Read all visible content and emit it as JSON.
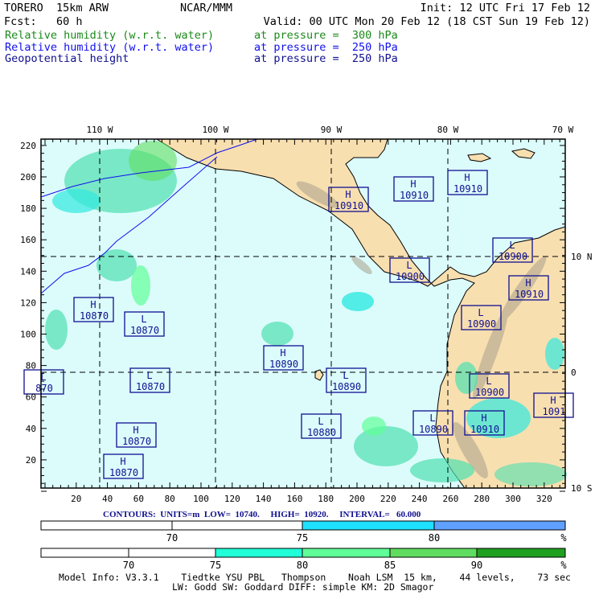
{
  "header": {
    "model": "TORERO  15km ARW",
    "center": "NCAR/MMM",
    "init": "Init: 12 UTC Fri 17 Feb 12",
    "fcst": "Fcst:   60 h",
    "valid": "Valid: 00 UTC Mon 20 Feb 12 (18 CST Sun 19 Feb 12)"
  },
  "fields": [
    {
      "name": "Relative humidity (w.r.t. water)",
      "level": "at pressure =  300 hPa",
      "color": "#1a8a1a"
    },
    {
      "name": "Relative humidity (w.r.t. water)",
      "level": "at pressure =  250 hPa",
      "color": "#1010ee"
    },
    {
      "name": "Geopotential height",
      "level": "at pressure =  250 hPa",
      "color": "#101090"
    }
  ],
  "map": {
    "lon_labels": [
      "110 W",
      "100 W",
      "90 W",
      "80 W",
      "70 W"
    ],
    "lat_labels": [
      "10 N",
      "0",
      "10 S"
    ],
    "x_ticks": [
      "20",
      "40",
      "60",
      "80",
      "100",
      "120",
      "140",
      "160",
      "180",
      "200",
      "220",
      "240",
      "260",
      "280",
      "300",
      "320"
    ],
    "y_ticks": [
      "20",
      "40",
      "60",
      "80",
      "100",
      "120",
      "140",
      "160",
      "180",
      "200",
      "220"
    ],
    "colors": {
      "ocean": "#dcfcfc",
      "land": "#f8dfb0",
      "contour": "#101090"
    },
    "centers": [
      {
        "type": "H",
        "value": "10910"
      },
      {
        "type": "H",
        "value": "10910"
      },
      {
        "type": "H",
        "value": "10910"
      },
      {
        "type": "L",
        "value": "10900"
      },
      {
        "type": "L",
        "value": "10900"
      },
      {
        "type": "H",
        "value": "10910"
      },
      {
        "type": "L",
        "value": "10900"
      },
      {
        "type": "H",
        "value": "10870"
      },
      {
        "type": "L",
        "value": "10870"
      },
      {
        "type": "H",
        "value": "10890"
      },
      {
        "type": "L",
        "value": "10890"
      },
      {
        "type": "L",
        "value": "870"
      },
      {
        "type": "L",
        "value": "10870"
      },
      {
        "type": "L",
        "value": "10900"
      },
      {
        "type": "H",
        "value": "1091"
      },
      {
        "type": "L",
        "value": "10880"
      },
      {
        "type": "L",
        "value": "10890"
      },
      {
        "type": "H",
        "value": "10910"
      },
      {
        "type": "H",
        "value": "10870"
      },
      {
        "type": "H",
        "value": "10870"
      }
    ]
  },
  "contours": {
    "text": "CONTOURS:  UNITS=m  LOW=  10740.     HIGH=  10920.     INTERVAL=   60.000"
  },
  "colorbar_250": {
    "labels": [
      "70",
      "75",
      "80",
      "%"
    ],
    "colors": [
      "#ffffff",
      "#ffffff",
      "#1ee0ff",
      "#60a0ff"
    ]
  },
  "colorbar_300": {
    "labels": [
      "70",
      "75",
      "80",
      "85",
      "90",
      "%"
    ],
    "colors": [
      "#ffffff",
      "#ffffff",
      "#20ffd8",
      "#60ff98",
      "#60dd60",
      "#20a020"
    ]
  },
  "footer": {
    "line1": "Model Info: V3.3.1    Tiedtke YSU PBL   Thompson    Noah LSM  15 km,    44 levels,    73 sec",
    "line2": "LW: Godd SW: Goddard DIFF: simple KM: 2D Smagor"
  }
}
